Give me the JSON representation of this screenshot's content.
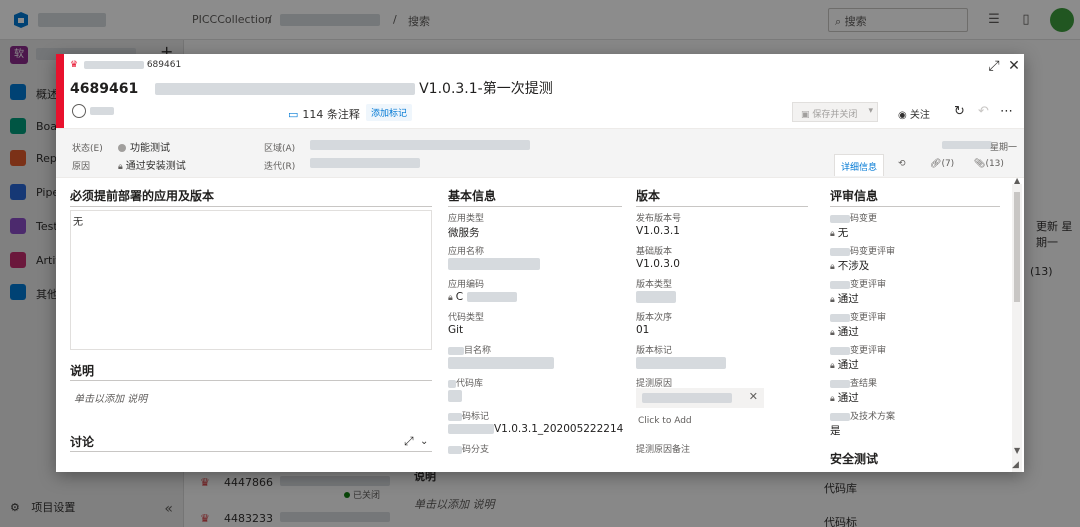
{
  "topbar": {
    "crumbs": [
      "PICCCollection",
      "/",
      "/",
      "搜索"
    ],
    "search_placeholder": "搜索"
  },
  "leftnav": {
    "project_badge": "软",
    "items": [
      {
        "label": "概述",
        "color": "#0078d4"
      },
      {
        "label": "Boar",
        "color": "#009b7a"
      },
      {
        "label": "Repo",
        "color": "#e05a2b"
      },
      {
        "label": "Pipel",
        "color": "#2866d6"
      },
      {
        "label": "Test",
        "color": "#8a4ec7"
      },
      {
        "label": "Artif",
        "color": "#c42d6e"
      },
      {
        "label": "其他",
        "color": "#0078d4"
      }
    ],
    "settings_label": "项目设置"
  },
  "background": {
    "rows": [
      {
        "id": "4447866",
        "status": "已关闭"
      },
      {
        "id": "4483233",
        "status": ""
      }
    ],
    "desc_label": "说明",
    "desc_placeholder": "单击以添加 说明",
    "right_badge": "(13)",
    "right_text": "更新 星期一",
    "footer_labels": [
      "代码库",
      "代码标"
    ]
  },
  "dialog": {
    "type_line": "689461",
    "id": "4689461",
    "title_suffix": "V1.0.3.1-第一次提测",
    "comments": "114 条注释",
    "add_tag": "添加标记",
    "save_btn": "保存并关闭",
    "follow": "关注",
    "meta": {
      "state_label": "状态(E)",
      "state_value": "功能测试",
      "reason_label": "原因",
      "reason_value": "通过安装测试",
      "area_label": "区域(A)",
      "iteration_label": "迭代(R)",
      "updated": "星期一"
    },
    "tabs": {
      "details": "详细信息",
      "links": "(7)",
      "attachments": "(13)"
    },
    "col1": {
      "header": "必须提前部署的应用及版本",
      "value": "无",
      "desc_header": "说明",
      "desc_placeholder": "单击以添加 说明",
      "discussion_header": "讨论"
    },
    "col2": {
      "header": "基本信息",
      "fields": [
        {
          "label": "应用类型",
          "value": "微服务"
        },
        {
          "label": "应用名称",
          "value": ""
        },
        {
          "label": "应用编码",
          "value": "C"
        },
        {
          "label": "代码类型",
          "value": "Git"
        },
        {
          "label": "目名称",
          "value": ""
        },
        {
          "label": "代码库",
          "value": ""
        },
        {
          "label": "码标记",
          "value": "V1.0.3.1_202005222214"
        },
        {
          "label": "码分支",
          "value": ""
        }
      ]
    },
    "col3": {
      "header": "版本",
      "fields": [
        {
          "label": "发布版本号",
          "value": "V1.0.3.1"
        },
        {
          "label": "基础版本",
          "value": "V1.0.3.0"
        },
        {
          "label": "版本类型",
          "value": ""
        },
        {
          "label": "版本次序",
          "value": "01"
        },
        {
          "label": "版本标记",
          "value": ""
        },
        {
          "label": "提测原因",
          "value": ""
        }
      ],
      "click_to_add": "Click to Add",
      "reason_note": "提测原因备注"
    },
    "col4": {
      "header": "评审信息",
      "fields": [
        {
          "label": "码变更",
          "value": "无"
        },
        {
          "label": "码变更评审",
          "value": "不涉及"
        },
        {
          "label": "变更评审",
          "value": "通过"
        },
        {
          "label": "变更评审",
          "value": "通过"
        },
        {
          "label": "变更评审",
          "value": "通过"
        },
        {
          "label": "查结果",
          "value": "通过"
        },
        {
          "label": "及技术方案",
          "value": "是"
        }
      ],
      "security_header": "安全测试"
    }
  }
}
